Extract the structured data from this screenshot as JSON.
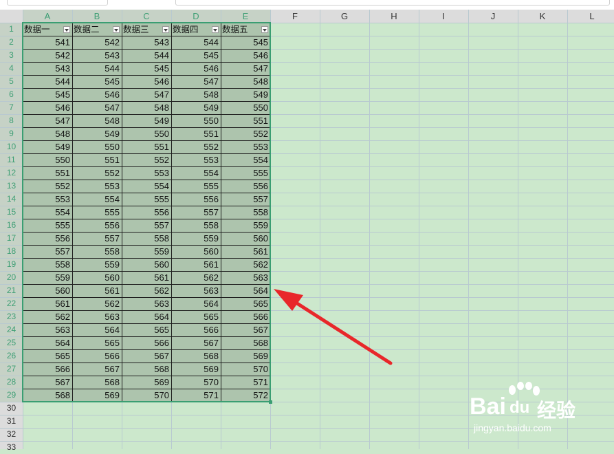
{
  "columns": [
    "A",
    "B",
    "C",
    "D",
    "E",
    "F",
    "G",
    "H",
    "I",
    "J",
    "K",
    "L"
  ],
  "rows": [
    "1",
    "2",
    "3",
    "4",
    "5",
    "6",
    "7",
    "8",
    "9",
    "10",
    "11",
    "12",
    "13",
    "14",
    "15",
    "16",
    "17",
    "18",
    "19",
    "20",
    "21",
    "22",
    "23",
    "24",
    "25",
    "26",
    "27",
    "28",
    "29",
    "30",
    "31",
    "32",
    "33"
  ],
  "table": {
    "headers": [
      "数据一",
      "数据二",
      "数据三",
      "数据四",
      "数据五"
    ],
    "data": [
      [
        541,
        542,
        543,
        544,
        545
      ],
      [
        542,
        543,
        544,
        545,
        546
      ],
      [
        543,
        544,
        545,
        546,
        547
      ],
      [
        544,
        545,
        546,
        547,
        548
      ],
      [
        545,
        546,
        547,
        548,
        549
      ],
      [
        546,
        547,
        548,
        549,
        550
      ],
      [
        547,
        548,
        549,
        550,
        551
      ],
      [
        548,
        549,
        550,
        551,
        552
      ],
      [
        549,
        550,
        551,
        552,
        553
      ],
      [
        550,
        551,
        552,
        553,
        554
      ],
      [
        551,
        552,
        553,
        554,
        555
      ],
      [
        552,
        553,
        554,
        555,
        556
      ],
      [
        553,
        554,
        555,
        556,
        557
      ],
      [
        554,
        555,
        556,
        557,
        558
      ],
      [
        555,
        556,
        557,
        558,
        559
      ],
      [
        556,
        557,
        558,
        559,
        560
      ],
      [
        557,
        558,
        559,
        560,
        561
      ],
      [
        558,
        559,
        560,
        561,
        562
      ],
      [
        559,
        560,
        561,
        562,
        563
      ],
      [
        560,
        561,
        562,
        563,
        564
      ],
      [
        561,
        562,
        563,
        564,
        565
      ],
      [
        562,
        563,
        564,
        565,
        566
      ],
      [
        563,
        564,
        565,
        566,
        567
      ],
      [
        564,
        565,
        566,
        567,
        568
      ],
      [
        565,
        566,
        567,
        568,
        569
      ],
      [
        566,
        567,
        568,
        569,
        570
      ],
      [
        567,
        568,
        569,
        570,
        571
      ],
      [
        568,
        569,
        570,
        571,
        572
      ]
    ]
  },
  "colors": {
    "sheet_bg": "#cce8cc",
    "selected_fill": "#adc4ad",
    "selection_border": "#3a9e72",
    "arrow": "#e8272a",
    "header_selected": "#3f9f75"
  },
  "watermark": {
    "logo_text": "Bai",
    "logo_text2": "du",
    "brand": "经验",
    "url": "jingyan.baidu.com"
  }
}
